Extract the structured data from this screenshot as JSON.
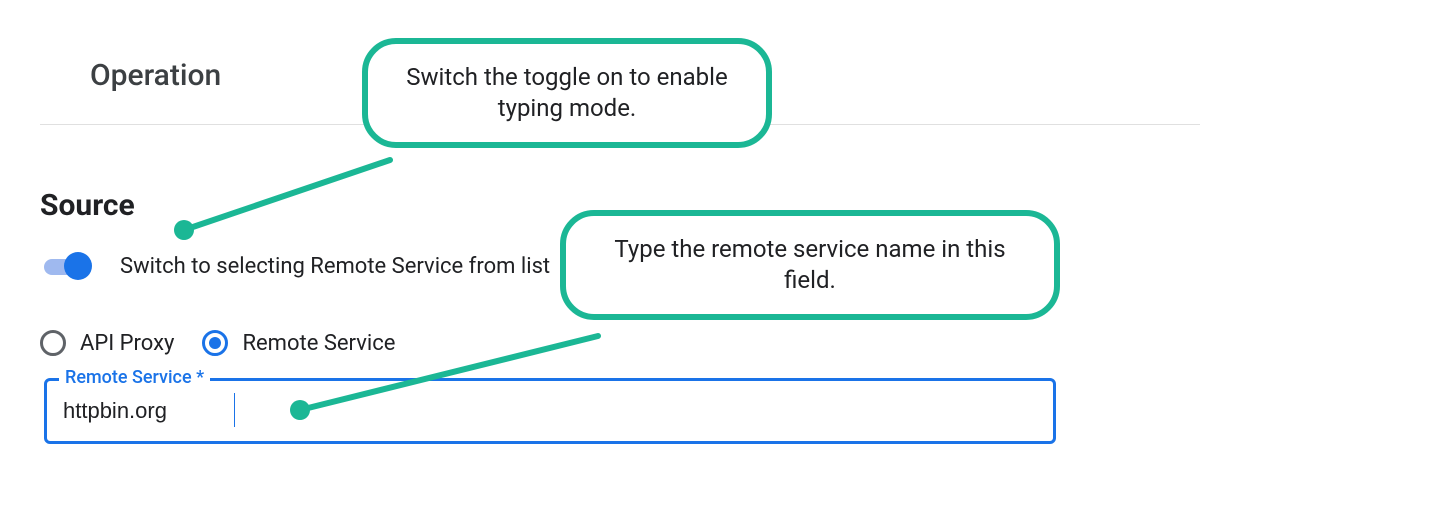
{
  "operation": {
    "heading": "Operation"
  },
  "source": {
    "heading": "Source",
    "toggle_label": "Switch to selecting Remote Service from list",
    "radios": {
      "api_proxy_label": "API Proxy",
      "remote_service_label": "Remote Service"
    },
    "field": {
      "floating_label": "Remote Service *",
      "value": "httpbin.org"
    }
  },
  "callouts": {
    "toggle_hint": "Switch the toggle on to enable typing mode.",
    "field_hint": "Type the remote service name in this field."
  },
  "colors": {
    "accent_blue": "#1a73e8",
    "annotation_green": "#1bb795"
  }
}
